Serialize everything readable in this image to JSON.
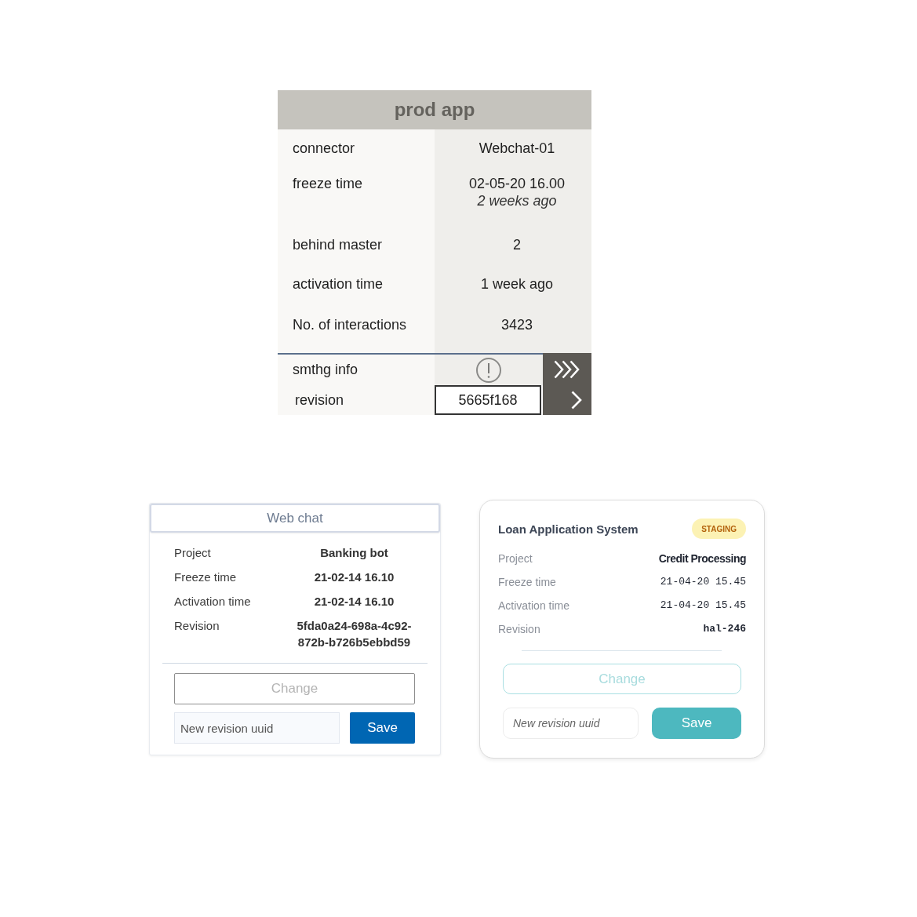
{
  "prod_app": {
    "title": "prod app",
    "rows": [
      {
        "label": "connector",
        "value": "Webchat-01"
      },
      {
        "label": "freeze time",
        "value": "02-05-20 16.00",
        "note": "2 weeks ago"
      },
      {
        "label": "behind master",
        "value": "2"
      },
      {
        "label": "activation time",
        "value": "1 week ago"
      },
      {
        "label": "No. of interactions",
        "value": "3423"
      }
    ],
    "info": {
      "label": "smthg info"
    },
    "revision": {
      "label": "revision",
      "value": "5665f168"
    }
  },
  "web_chat": {
    "title": "Web chat",
    "rows": [
      {
        "label": "Project",
        "value": "Banking bot"
      },
      {
        "label": "Freeze time",
        "value": "21-02-14 16.10"
      },
      {
        "label": "Activation time",
        "value": "21-02-14 16.10"
      },
      {
        "label": "Revision",
        "value": "5fda0a24-698a-4c92-872b-b726b5ebbd59"
      }
    ],
    "change_button": {
      "label": "Change",
      "disabled": true
    },
    "revision_field": {
      "placeholder": "New revision uuid"
    },
    "save_button": "Save"
  },
  "loan_app": {
    "title": "Loan Application System",
    "badge": "STAGING",
    "rows": [
      {
        "label": "Project",
        "value": "Credit Processing",
        "kind": "text"
      },
      {
        "label": "Freeze time",
        "value": "21-04-20 15.45",
        "kind": "time"
      },
      {
        "label": "Activation time",
        "value": "21-04-20 15.45",
        "kind": "time"
      },
      {
        "label": "Revision",
        "value": "hal-246",
        "kind": "code"
      }
    ],
    "change_button": {
      "label": "Change",
      "disabled": true
    },
    "revision_field": {
      "placeholder": "New revision uuid"
    },
    "save_button": "Save"
  }
}
